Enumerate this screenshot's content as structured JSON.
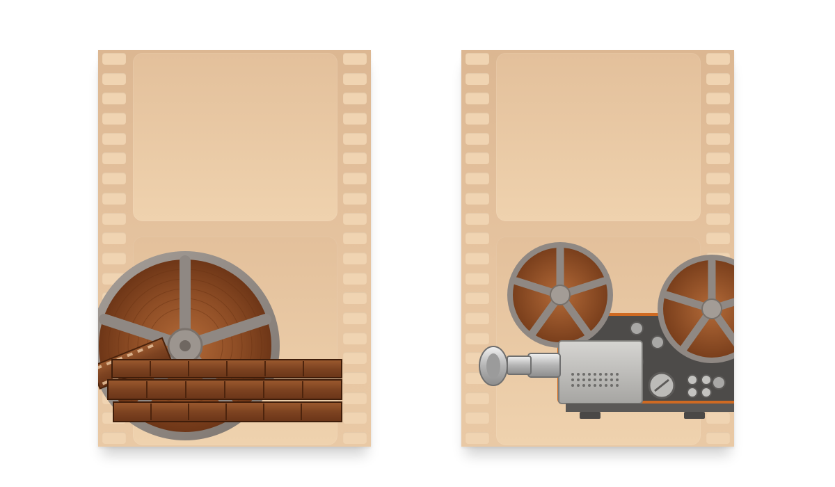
{
  "colors": {
    "card": "#e1bd98",
    "frame": "#ebcba7",
    "sprocket": "#f0d4b2",
    "reel_metal": "#8f8883",
    "film_brown": "#8a4a22",
    "projector_body": "#b8b7b4"
  },
  "posters": [
    {
      "name": "film-reel-poster",
      "illustration": "film-reel-with-film-strips-icon"
    },
    {
      "name": "projector-poster",
      "illustration": "film-projector-icon"
    }
  ]
}
